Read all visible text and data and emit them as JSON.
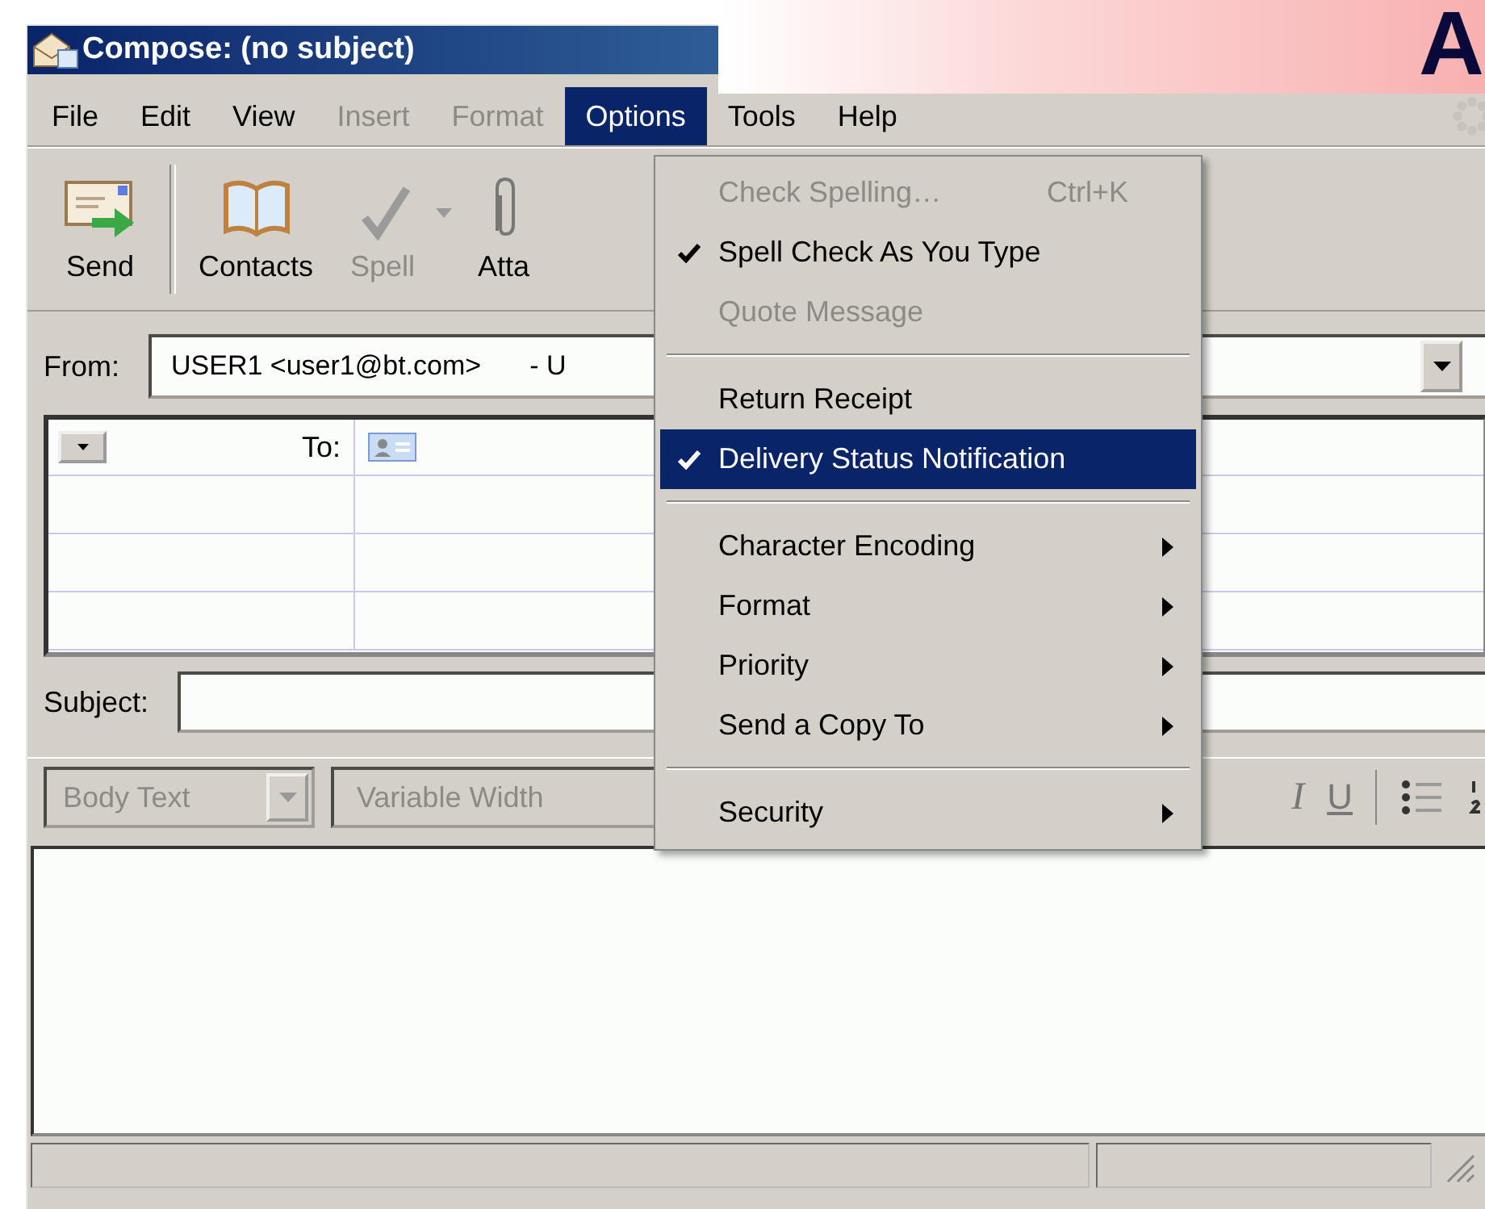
{
  "window": {
    "title": "Compose: (no subject)"
  },
  "banner": {
    "text": "A"
  },
  "menubar": [
    {
      "label": "File",
      "disabled": false,
      "selected": false
    },
    {
      "label": "Edit",
      "disabled": false,
      "selected": false
    },
    {
      "label": "View",
      "disabled": false,
      "selected": false
    },
    {
      "label": "Insert",
      "disabled": true,
      "selected": false
    },
    {
      "label": "Format",
      "disabled": true,
      "selected": false
    },
    {
      "label": "Options",
      "disabled": false,
      "selected": true
    },
    {
      "label": "Tools",
      "disabled": false,
      "selected": false
    },
    {
      "label": "Help",
      "disabled": false,
      "selected": false
    }
  ],
  "toolbar": [
    {
      "kind": "send",
      "label": "Send",
      "disabled": false
    },
    {
      "kind": "contacts",
      "label": "Contacts",
      "disabled": false
    },
    {
      "kind": "spell",
      "label": "Spell",
      "disabled": true
    },
    {
      "kind": "attach",
      "label": "Atta",
      "disabled": false
    }
  ],
  "from": {
    "label": "From:",
    "value": "USER1 <user1@bt.com>",
    "extra": "- U"
  },
  "addressing": {
    "type_label": "To:"
  },
  "subject": {
    "label": "Subject:"
  },
  "format_toolbar": {
    "paragraph": "Body Text",
    "font": "Variable Width",
    "italic": "I",
    "underline": "U"
  },
  "options_menu": [
    {
      "kind": "item",
      "label": "Check Spelling…",
      "shortcut": "Ctrl+K",
      "disabled": true,
      "checked": false,
      "selected": false
    },
    {
      "kind": "item",
      "label": "Spell Check As You Type",
      "disabled": false,
      "checked": true,
      "selected": false
    },
    {
      "kind": "item",
      "label": "Quote Message",
      "disabled": true,
      "checked": false,
      "selected": false
    },
    {
      "kind": "separator"
    },
    {
      "kind": "item",
      "label": "Return Receipt",
      "disabled": false,
      "checked": false,
      "selected": false
    },
    {
      "kind": "item",
      "label": "Delivery Status Notification",
      "disabled": false,
      "checked": true,
      "selected": true
    },
    {
      "kind": "separator"
    },
    {
      "kind": "submenu",
      "label": "Character Encoding",
      "selected": false
    },
    {
      "kind": "submenu",
      "label": "Format",
      "selected": false
    },
    {
      "kind": "submenu",
      "label": "Priority",
      "selected": false
    },
    {
      "kind": "submenu",
      "label": "Send a Copy To",
      "selected": false
    },
    {
      "kind": "separator"
    },
    {
      "kind": "submenu",
      "label": "Security",
      "selected": false
    }
  ]
}
